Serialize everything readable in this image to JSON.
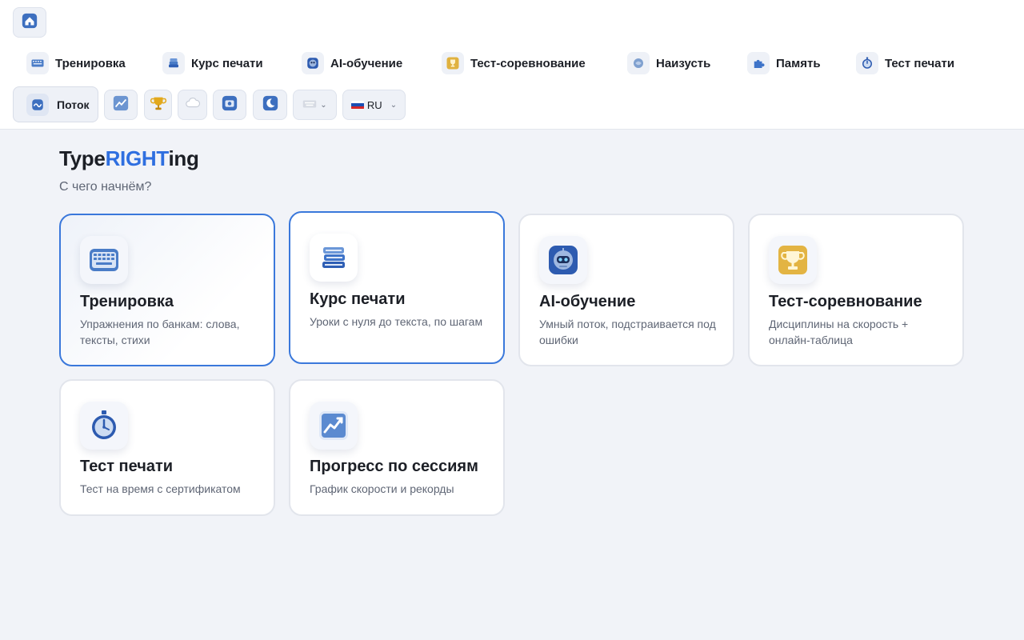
{
  "nav": {
    "home_icon": "home-icon",
    "items": [
      {
        "label": "Тренировка",
        "icon": "keyboard-icon"
      },
      {
        "label": "Курс печати",
        "icon": "books-icon"
      },
      {
        "label": "AI-обучение",
        "icon": "robot-icon"
      },
      {
        "label": "Тест-соревнование",
        "icon": "trophy-icon"
      },
      {
        "label": "Наизусть",
        "icon": "brain-icon"
      },
      {
        "label": "Память",
        "icon": "puzzle-icon"
      },
      {
        "label": "Тест печати",
        "icon": "stopwatch-icon"
      }
    ]
  },
  "toolbar": {
    "flow_label": "Поток",
    "buttons": [
      "chart-icon",
      "trophy-icon",
      "cloud-icon",
      "camera-icon",
      "moon-icon"
    ],
    "keyboard_select": {
      "icon": "keyboard-icon"
    },
    "language_select": {
      "value": "RU",
      "flag": "russia-flag-icon"
    }
  },
  "brand": {
    "part1": "Type",
    "part2": "RIGHT",
    "part3": "ing"
  },
  "subtitle": "С чего начнём?",
  "cards": [
    {
      "title": "Тренировка",
      "desc": "Упражнения по банкам: слова, тексты, стихи",
      "icon": "keyboard-icon"
    },
    {
      "title": "Курс печати",
      "desc": "Уроки с нуля до текста, по шагам",
      "icon": "books-icon"
    },
    {
      "title": "AI-обучение",
      "desc": "Умный поток, подстраивается под ошибки",
      "icon": "robot-icon"
    },
    {
      "title": "Тест-соревнование",
      "desc": "Дисциплины на скорость + онлайн-таблица",
      "icon": "trophy-icon"
    },
    {
      "title": "Тест печати",
      "desc": "Тест на время с сертификатом",
      "icon": "stopwatch-icon"
    },
    {
      "title": "Прогресс по сессиям",
      "desc": "График скорости и рекорды",
      "icon": "chart-icon"
    }
  ],
  "colors": {
    "accent": "#2f6fe0",
    "active_border": "#3a78db",
    "background": "#f1f3f8"
  }
}
